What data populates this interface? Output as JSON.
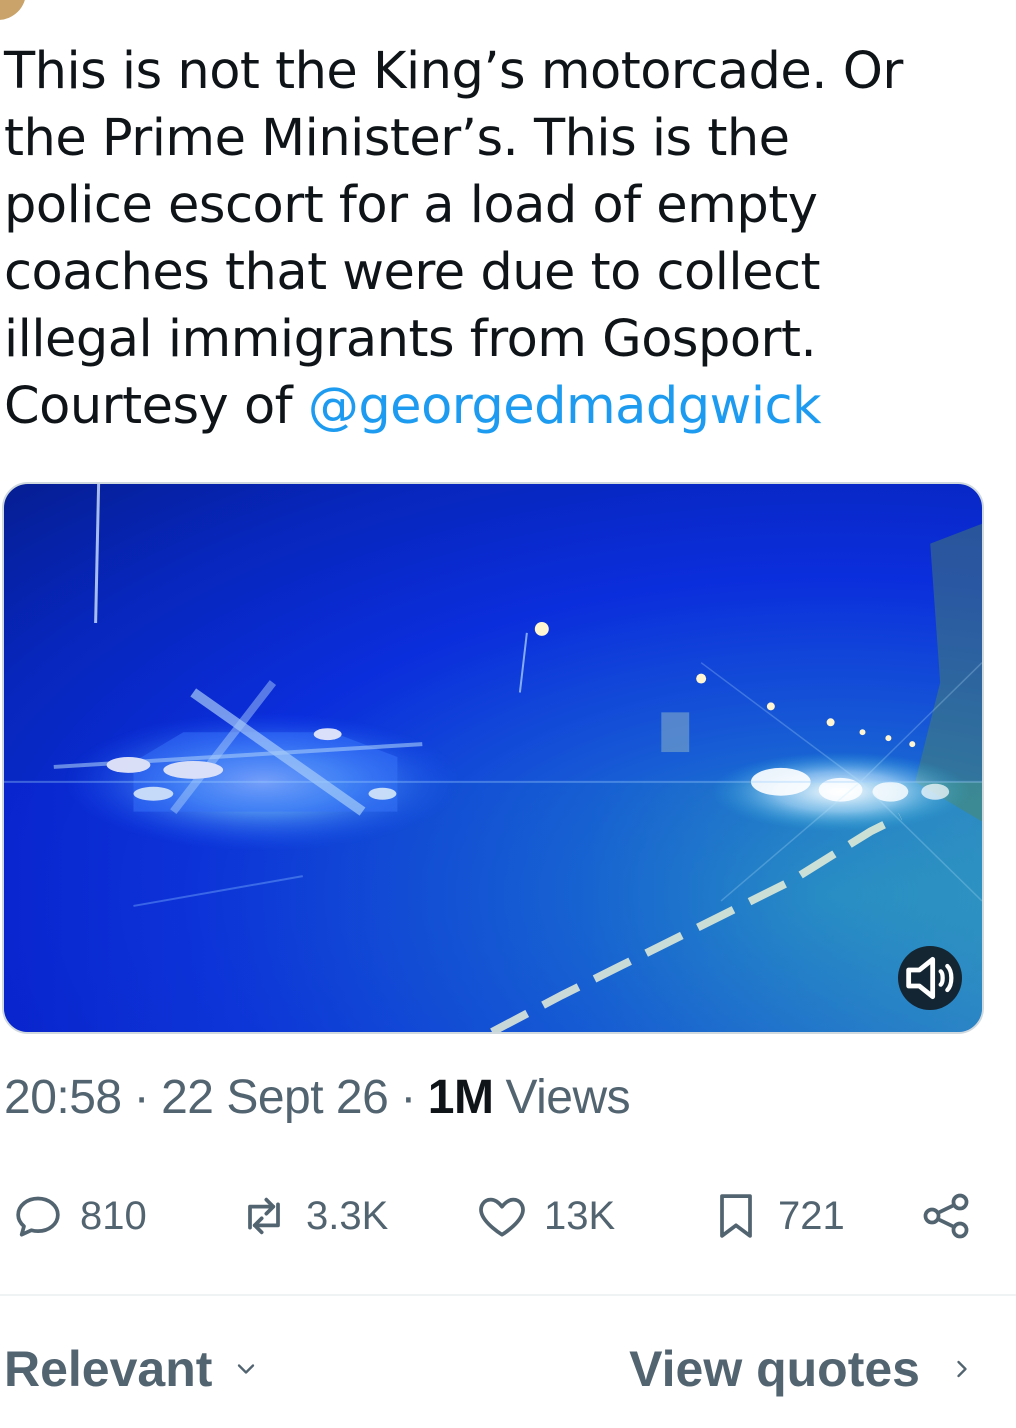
{
  "tweet": {
    "text_lines": [
      "This is not the King’s motorcade. Or",
      "the Prime Minister’s. This is the",
      "police escort for a load of empty",
      "coaches that were due to collect",
      "illegal immigrants from Gosport.",
      "Courtesy of "
    ],
    "mention": "@georgedmadgwick"
  },
  "media": {
    "type": "video",
    "sound_icon": "speaker-muted-icon"
  },
  "meta": {
    "time": "20:58",
    "dot1": "·",
    "date": "22 Sept 26",
    "dot2": "·",
    "views_count": "1M",
    "views_label": "Views"
  },
  "actions": {
    "replies": {
      "icon": "reply-icon",
      "count": "810"
    },
    "reposts": {
      "icon": "repost-icon",
      "count": "3.3K"
    },
    "likes": {
      "icon": "heart-icon",
      "count": "13K"
    },
    "bookmarks": {
      "icon": "bookmark-icon",
      "count": "721"
    },
    "share": {
      "icon": "share-icon"
    }
  },
  "footer": {
    "sort_label": "Relevant",
    "view_quotes_label": "View quotes"
  },
  "colors": {
    "text": "#0f1419",
    "secondary": "#536471",
    "accent": "#1d9bf0"
  }
}
